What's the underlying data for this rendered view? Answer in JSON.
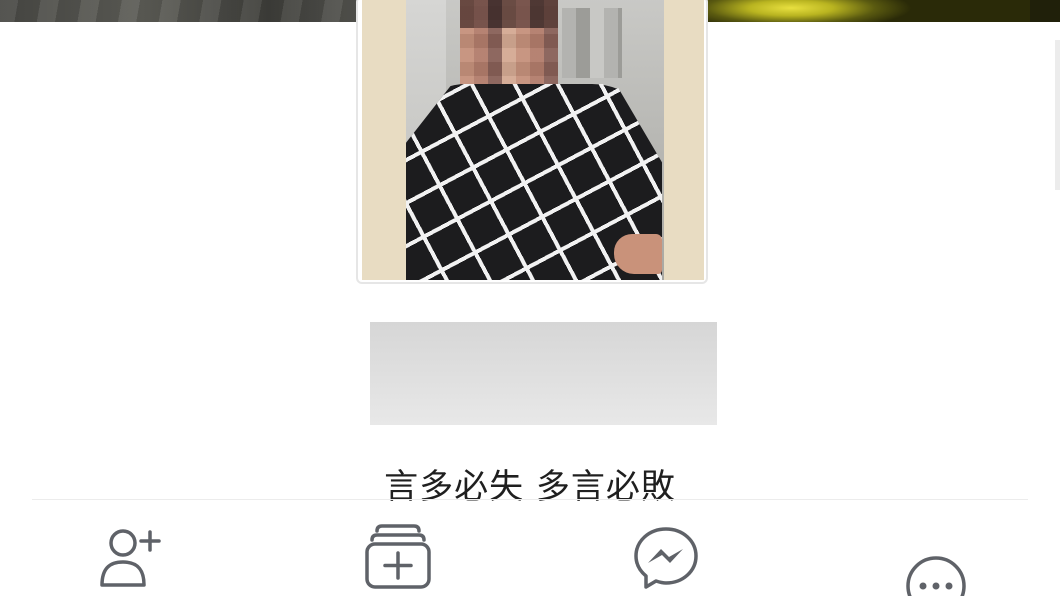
{
  "profile": {
    "bio": "言多必失 多言必敗"
  },
  "actions": [
    {
      "icon": "add-friend-icon"
    },
    {
      "icon": "add-story-icon"
    },
    {
      "icon": "messenger-icon"
    },
    {
      "icon": "more-icon"
    }
  ],
  "colors": {
    "icon_stroke": "#5f6268",
    "text": "#1f1f1f",
    "background": "#ffffff",
    "redacted_box": "#dedede"
  }
}
